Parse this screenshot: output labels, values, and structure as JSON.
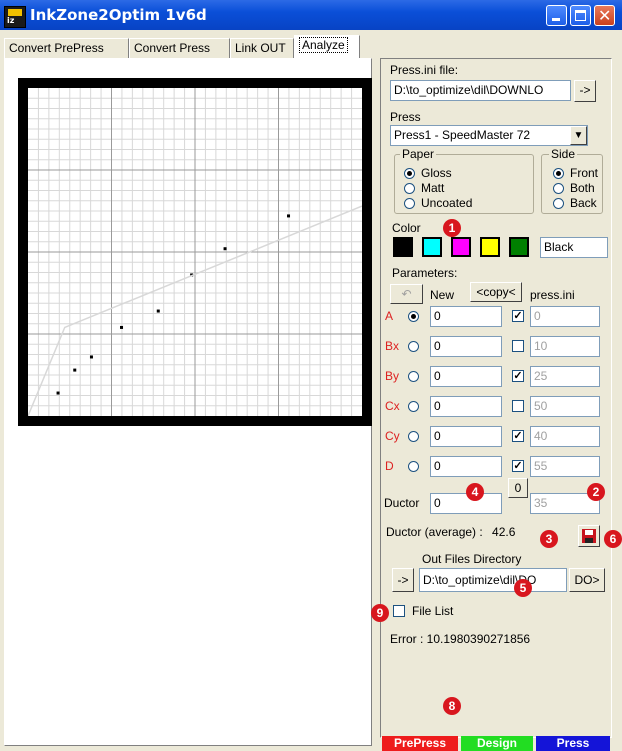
{
  "window": {
    "title": "InkZone2Optim 1v6d",
    "app_icon_text": "iz"
  },
  "tabs": [
    {
      "label": "Convert PrePress"
    },
    {
      "label": "Convert Press"
    },
    {
      "label": "Link OUT"
    },
    {
      "label": "Analyze",
      "active": true
    }
  ],
  "chart_data": {
    "type": "scatter",
    "title": "",
    "xlabel": "",
    "ylabel": "",
    "xlim": [
      0,
      100
    ],
    "ylim": [
      0,
      100
    ],
    "grid": true,
    "series": [
      {
        "type": "scatter",
        "x": [
          9,
          14,
          19,
          28,
          39,
          49,
          59,
          78
        ],
        "y": [
          7,
          14,
          18,
          27,
          32,
          43,
          51,
          61
        ]
      },
      {
        "type": "line",
        "color": "#d8d8d8",
        "x": [
          0,
          11,
          100
        ],
        "y": [
          0,
          27,
          64
        ]
      }
    ]
  },
  "panel": {
    "press_ini_label": "Press.ini file:",
    "press_ini_value": "D:\\to_optimize\\dil\\DOWNLO",
    "press_ini_button": "->",
    "press_label": "Press",
    "press_value": "Press1 - SpeedMaster 72",
    "paper": {
      "title": "Paper",
      "options": [
        {
          "label": "Gloss",
          "selected": true
        },
        {
          "label": "Matt",
          "selected": false
        },
        {
          "label": "Uncoated",
          "selected": false
        }
      ]
    },
    "side": {
      "title": "Side",
      "options": [
        {
          "label": "Front",
          "selected": true
        },
        {
          "label": "Both",
          "selected": false
        },
        {
          "label": "Back",
          "selected": false
        }
      ]
    },
    "color_label": "Color",
    "colors": [
      "#000000",
      "#00ffff",
      "#ff00ff",
      "#ffff00",
      "#008000"
    ],
    "color_value": "Black",
    "parameters_label": "Parameters:",
    "undo_icon": "undo-icon",
    "new_label": "New",
    "copy_button": "<copy<",
    "press_ini_col": "press.ini",
    "params": [
      {
        "name": "A",
        "new": "0",
        "checked": true,
        "ini": "0",
        "selected": true
      },
      {
        "name": "Bx",
        "new": "0",
        "checked": false,
        "ini": "10",
        "selected": false
      },
      {
        "name": "By",
        "new": "0",
        "checked": true,
        "ini": "25",
        "selected": false
      },
      {
        "name": "Cx",
        "new": "0",
        "checked": false,
        "ini": "50",
        "selected": false
      },
      {
        "name": "Cy",
        "new": "0",
        "checked": true,
        "ini": "40",
        "selected": false
      },
      {
        "name": "D",
        "new": "0",
        "checked": true,
        "ini": "55",
        "selected": false
      }
    ],
    "zero_button": "0",
    "ductor_label": "Ductor",
    "ductor_new": "0",
    "ductor_ini": "35",
    "ductor_avg_label": "Ductor (average) :",
    "ductor_avg_value": "42.6",
    "out_dir_label": "Out Files Directory",
    "out_dir_button": "->",
    "out_dir_value": "D:\\to_optimize\\dil\\DO",
    "do_button": "DO>",
    "file_list_label": "File List",
    "error_text": "Error : 10.1980390271856"
  },
  "modes": [
    {
      "label": "PrePress",
      "color": "#ee1c1c"
    },
    {
      "label": "Design",
      "color": "#22dd22"
    },
    {
      "label": "Press",
      "color": "#1414d8"
    }
  ],
  "badges": [
    "1",
    "2",
    "3",
    "4",
    "5",
    "6",
    "8",
    "9"
  ]
}
